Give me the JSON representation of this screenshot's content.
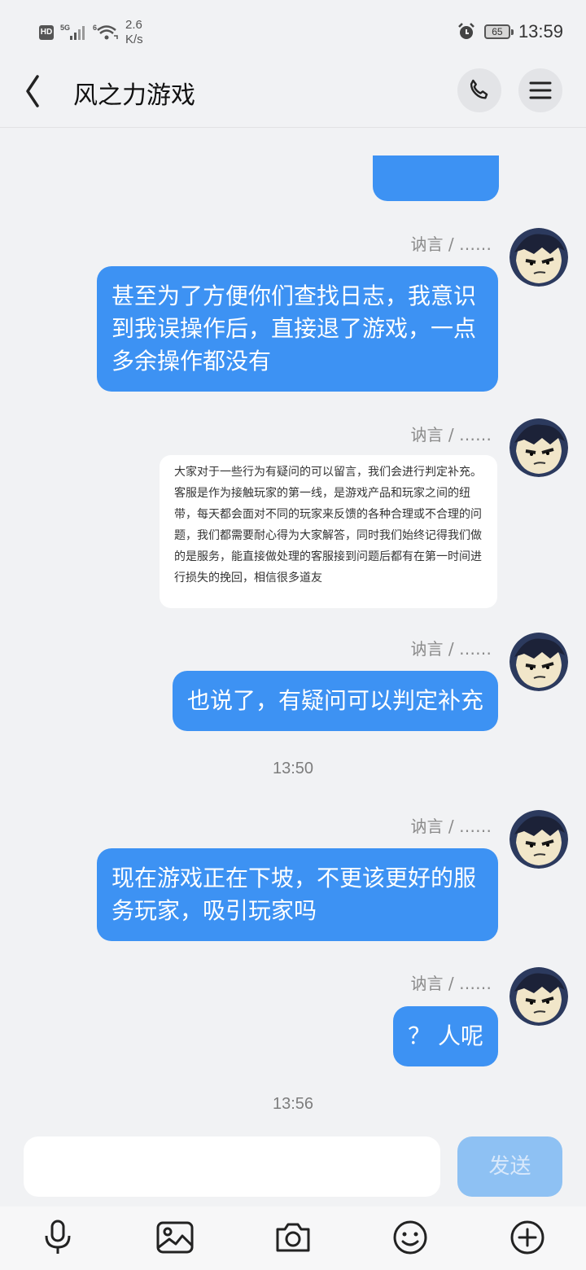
{
  "status_bar": {
    "hd": "HD",
    "net1": "5G",
    "net2": "6",
    "speed_value": "2.6",
    "speed_unit": "K/s",
    "battery": "65",
    "time": "13:59"
  },
  "header": {
    "title": "风之力游戏",
    "icons": [
      "back-arrow-icon",
      "phone-icon",
      "menu-icon"
    ]
  },
  "messages": [
    {
      "sender": "讷言 / ……",
      "text": "甚至为了方便你们查找日志，我意识到我误操作后，直接退了游戏，一点多余操作都没有"
    },
    {
      "sender": "讷言 / ……",
      "image_text": "大家对于一些行为有疑问的可以留言，我们会进行判定补充。\n客服是作为接触玩家的第一线，是游戏产品和玩家之间的纽带，每天都会面对不同的玩家来反馈的各种合理或不合理的问题，我们都需要耐心得为大家解答，同时我们始终记得我们做的是服务，能直接做处理的客服接到问题后都有在第一时间进行损失的挽回，相信很多道友"
    },
    {
      "sender": "讷言 / ……",
      "text": "也说了，有疑问可以判定补充"
    },
    {
      "sender": "讷言 / ……",
      "text": "现在游戏正在下坡，不更该更好的服务玩家，吸引玩家吗"
    },
    {
      "sender": "讷言 / ……",
      "text": "？ 人呢"
    }
  ],
  "timestamps": [
    "13:50",
    "13:56"
  ],
  "composer": {
    "send_label": "发送",
    "tools": [
      "microphone-icon",
      "image-icon",
      "camera-icon",
      "emoji-icon",
      "plus-icon"
    ]
  },
  "colors": {
    "bubble": "#3d92f3",
    "send_disabled": "#8ec1f3",
    "background": "#f1f2f4"
  }
}
